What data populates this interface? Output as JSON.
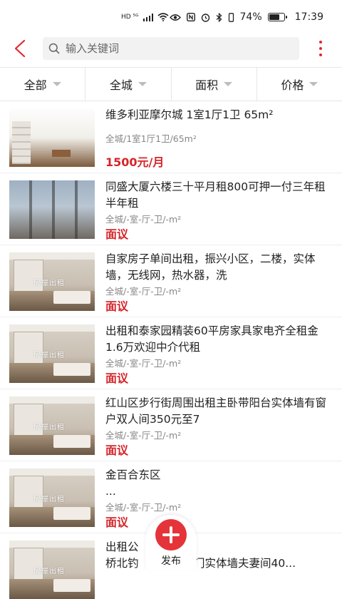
{
  "status_bar": {
    "left_indicators": "HD ⁵ᴳ",
    "battery": "74%",
    "time": "17:39",
    "battery_level": 0.74
  },
  "search": {
    "placeholder": "输入关键词"
  },
  "filters": [
    {
      "label": "全部"
    },
    {
      "label": "全城"
    },
    {
      "label": "面积"
    },
    {
      "label": "价格"
    }
  ],
  "listings": [
    {
      "title": "维多利亚摩尔城 1室1厅1卫 65m²",
      "meta": "全城/1室1厅1卫/65m²",
      "price": "1500元/月"
    },
    {
      "title": "同盛大厦六楼三十平月租800可押一付三年租半年租",
      "meta": "全城/-室-厅-卫/-m²",
      "price": "面议"
    },
    {
      "title": "自家房子单间出租，振兴小区，二楼，实体墙，无线网，热水器，洗",
      "meta": "全城/-室-厅-卫/-m²",
      "price": "面议"
    },
    {
      "title": "出租和泰家园精装60平房家具家电齐全租金1.6万欢迎中介代租",
      "meta": "全城/-室-厅-卫/-m²",
      "price": "面议"
    },
    {
      "title": "红山区步行街周围出租主卧带阳台实体墙有窗户双人间350元至7",
      "meta": "全城/-室-厅-卫/-m²",
      "price": "面议"
    },
    {
      "title": "金百合东区\n...",
      "meta": "全城/-室-厅-卫/-m²",
      "price": "面议"
    },
    {
      "title": "出租公　　　　　　　　\n桥北钓　　　　北门实体墙夫妻间40...",
      "meta": "",
      "price": ""
    }
  ],
  "thumbnail_watermark": "房屋出租",
  "fab": {
    "label": "发布"
  },
  "colors": {
    "accent": "#e0292c",
    "price": "#d5252a",
    "fab": "#e5333a"
  }
}
